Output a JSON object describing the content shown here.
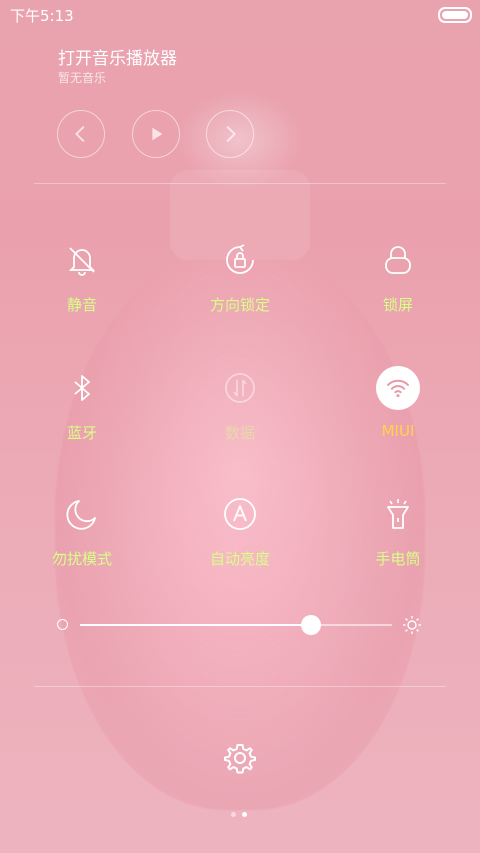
{
  "status_bar": {
    "time": "下午5:13"
  },
  "music": {
    "title": "打开音乐播放器",
    "subtitle": "暂无音乐",
    "controls": {
      "prev_icon": "chevron-left-icon",
      "play_icon": "play-icon",
      "next_icon": "chevron-right-icon"
    }
  },
  "toggles": [
    {
      "label": "静音",
      "icon": "bell-off-icon",
      "state": "off"
    },
    {
      "label": "方向锁定",
      "icon": "rotation-lock-icon",
      "state": "off"
    },
    {
      "label": "锁屏",
      "icon": "lock-icon",
      "state": "off"
    },
    {
      "label": "蓝牙",
      "icon": "bluetooth-icon",
      "state": "off"
    },
    {
      "label": "数据",
      "icon": "mobile-data-icon",
      "state": "disabled"
    },
    {
      "label": "MIUI",
      "icon": "wifi-icon",
      "state": "on"
    },
    {
      "label": "勿扰模式",
      "icon": "moon-icon",
      "state": "off"
    },
    {
      "label": "自动亮度",
      "icon": "auto-brightness-icon",
      "state": "off"
    },
    {
      "label": "手电筒",
      "icon": "flashlight-icon",
      "state": "off"
    }
  ],
  "brightness": {
    "level_fraction": 0.74
  },
  "colors": {
    "label_green": "#d9ff86",
    "label_active": "#ffd34a"
  },
  "pager": {
    "current": 2,
    "total": 2
  }
}
